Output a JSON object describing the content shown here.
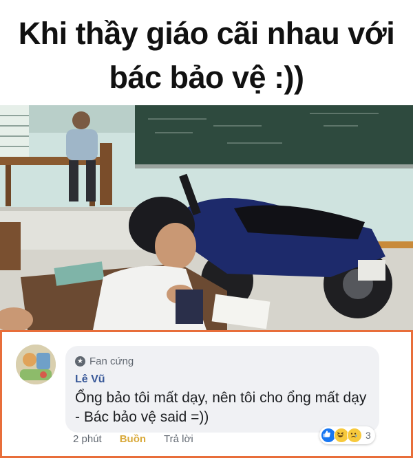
{
  "meme": {
    "title_line1": "Khi thầy giáo cãi nhau với",
    "title_line2": "bác bảo vệ :))"
  },
  "comment": {
    "badge_icon": "star-icon",
    "badge_text": "Fan cứng",
    "author": "Lê Vũ",
    "text": "Ổng bảo tôi mất dạy, nên tôi cho ổng mất dạy - Bác bảo vệ said =))",
    "time": "2 phút",
    "reaction_label": "Buồn",
    "reply_label": "Trả lời",
    "reaction_count": "3",
    "reaction_icons": [
      "like-icon",
      "haha-icon",
      "sad-icon"
    ]
  },
  "colors": {
    "border": "#e86e3a",
    "author": "#385898",
    "reaction_label": "#d9a93a"
  }
}
